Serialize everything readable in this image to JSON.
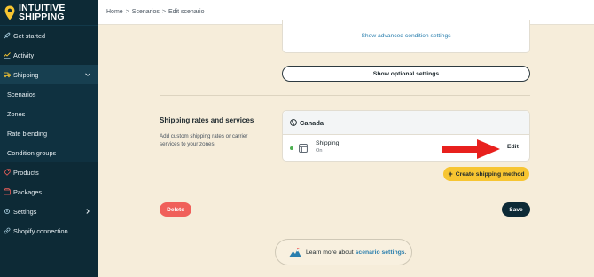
{
  "brand": {
    "line1": "INTUITIVE",
    "line2": "SHIPPING"
  },
  "breadcrumb": {
    "items": [
      "Home",
      "Scenarios",
      "Edit scenario"
    ],
    "separator": ">"
  },
  "sidebar": {
    "items": [
      {
        "label": "Get started",
        "icon": "rocket-icon"
      },
      {
        "label": "Activity",
        "icon": "activity-chart-icon"
      },
      {
        "label": "Shipping",
        "icon": "truck-icon"
      },
      {
        "label": "Scenarios"
      },
      {
        "label": "Zones"
      },
      {
        "label": "Rate blending"
      },
      {
        "label": "Condition groups"
      },
      {
        "label": "Products",
        "icon": "tag-icon"
      },
      {
        "label": "Packages",
        "icon": "package-icon"
      },
      {
        "label": "Settings",
        "icon": "gear-icon"
      },
      {
        "label": "Shopify connection",
        "icon": "link-icon"
      }
    ]
  },
  "conditions": {
    "advanced_link": "Show advanced condition settings"
  },
  "optional_settings_label": "Show optional settings",
  "rates_section": {
    "title": "Shipping rates and services",
    "description": "Add custom shipping rates or carrier services to your zones.",
    "zone_name": "Canada",
    "method": {
      "name": "Shipping",
      "status": "On",
      "edit_label": "Edit"
    },
    "create_label": "Create shipping method"
  },
  "actions": {
    "delete_label": "Delete",
    "save_label": "Save"
  },
  "learn_more": {
    "prefix": "Learn more about",
    "link": "scenario settings"
  },
  "colors": {
    "sidebar_bg": "#0d2a36",
    "page_bg": "#f6edda",
    "accent_yellow": "#f7c531",
    "delete_red": "#f0605a",
    "link_blue": "#2a7fae",
    "arrow_red": "#e8201d",
    "status_green": "#4caf50"
  }
}
